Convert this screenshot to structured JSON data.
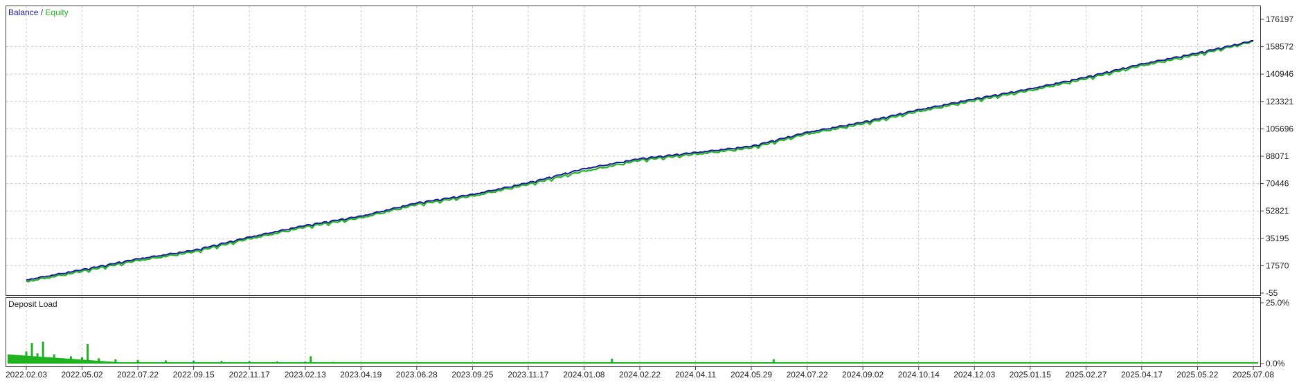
{
  "legend": {
    "balance_label": "Balance",
    "separator": " / ",
    "equity_label": "Equity",
    "balance_color": "#1a1a9c",
    "equity_color": "#22b522"
  },
  "deposit_panel": {
    "title": "Deposit Load",
    "color": "#1fb31f"
  },
  "chart_data": [
    {
      "type": "line",
      "legend_position": "top-left",
      "grid": true,
      "ylim": [
        -55,
        176197
      ],
      "y_ticks": [
        "176197",
        "158572",
        "140946",
        "123321",
        "105696",
        "88071",
        "70446",
        "52821",
        "35195",
        "17570",
        "-55"
      ],
      "x_ticks": [
        "2022.02.03",
        "2022.05.02",
        "2022.07.22",
        "2022.09.15",
        "2022.11.17",
        "2023.02.13",
        "2023.04.19",
        "2023.06.28",
        "2023.09.25",
        "2023.11.17",
        "2024.01.08",
        "2024.02.22",
        "2024.04.11",
        "2024.05.29",
        "2024.07.22",
        "2024.09.02",
        "2024.10.14",
        "2024.12.03",
        "2025.01.15",
        "2025.02.27",
        "2025.04.17",
        "2025.05.22",
        "2025.07.08"
      ],
      "series": [
        {
          "name": "Balance",
          "color": "#1a1a9c",
          "x_index": [
            0,
            1,
            2,
            3,
            4,
            5,
            6,
            7,
            8,
            9,
            10,
            11,
            12,
            13,
            14,
            15,
            16,
            17,
            18,
            19,
            20,
            21,
            22
          ],
          "values": [
            8500,
            15000,
            22000,
            27500,
            36000,
            43500,
            49500,
            58000,
            63500,
            71000,
            80000,
            86500,
            90500,
            94500,
            103500,
            110000,
            118000,
            125000,
            131500,
            139000,
            147500,
            154500,
            162500
          ]
        },
        {
          "name": "Equity",
          "color": "#22b522",
          "x_index": [
            0,
            1,
            2,
            3,
            4,
            5,
            6,
            7,
            8,
            9,
            10,
            11,
            12,
            13,
            14,
            15,
            16,
            17,
            18,
            19,
            20,
            21,
            22
          ],
          "values": [
            7500,
            14000,
            21000,
            26500,
            35000,
            42500,
            48500,
            57000,
            62500,
            70000,
            78500,
            85500,
            89500,
            93500,
            102500,
            109000,
            117000,
            124000,
            130500,
            138000,
            146500,
            153500,
            162000
          ]
        }
      ]
    },
    {
      "type": "bar",
      "title": "Deposit Load",
      "ylim": [
        0,
        25
      ],
      "y_ticks": [
        "25.0%",
        "0.0%"
      ],
      "x_index": [
        0,
        0.1,
        0.2,
        0.3,
        0.5,
        0.8,
        1.0,
        1.1,
        1.3,
        1.6,
        2.0,
        2.5,
        3.0,
        3.5,
        4.0,
        4.5,
        5.0,
        5.1,
        5.5,
        6.0,
        7.0,
        8.0,
        9.0,
        10.0,
        10.5,
        11.0,
        12.0,
        13.0,
        13.4,
        14.0,
        15.0,
        16.0,
        17.0,
        18.0,
        19.0,
        20.0,
        21.0,
        22.0
      ],
      "values": [
        5,
        8.5,
        4.2,
        9.0,
        3.8,
        3.0,
        2.6,
        8.0,
        2.2,
        1.8,
        1.5,
        1.3,
        1.2,
        1.1,
        1.0,
        0.9,
        0.8,
        3.0,
        0.7,
        0.6,
        0.6,
        0.5,
        0.5,
        0.5,
        2.0,
        0.5,
        0.5,
        0.5,
        1.8,
        0.5,
        0.5,
        0.5,
        0.5,
        0.5,
        0.5,
        0.5,
        0.5,
        0.5
      ]
    }
  ]
}
